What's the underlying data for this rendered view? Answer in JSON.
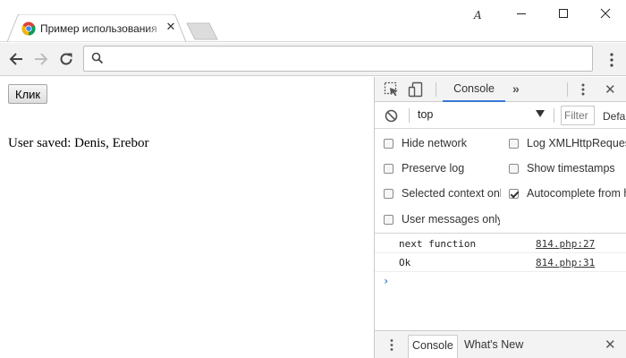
{
  "browser": {
    "tab": {
      "title": "Пример использования",
      "close_glyph": "✕",
      "active": true
    },
    "profile_label": "A",
    "omnibox": {
      "value": "",
      "placeholder": ""
    },
    "colors": {
      "accent": "#3879d9",
      "toolbar": "#f2f2f2"
    }
  },
  "page": {
    "button_label": "Клик",
    "output_text": "User saved: Denis, Erebor"
  },
  "devtools": {
    "tabs": [
      {
        "label": "Console",
        "active": true
      }
    ],
    "more_tabs_glyph": "»",
    "close_glyph": "✕",
    "context": "top",
    "filter_placeholder": "Filter",
    "levels_label": "Default levels",
    "settings": {
      "left": [
        {
          "label": "Hide network",
          "checked": false
        },
        {
          "label": "Preserve log",
          "checked": false
        },
        {
          "label": "Selected context only",
          "checked": false
        },
        {
          "label": "User messages only",
          "checked": false
        }
      ],
      "right": [
        {
          "label": "Log XMLHttpRequests",
          "checked": false
        },
        {
          "label": "Show timestamps",
          "checked": false
        },
        {
          "label": "Autocomplete from history",
          "checked": true
        }
      ]
    },
    "console_messages": [
      {
        "text": "next function",
        "source": "814.php:27"
      },
      {
        "text": "Ok",
        "source": "814.php:31"
      }
    ],
    "prompt_glyph": "›",
    "drawer": {
      "tabs": [
        {
          "label": "Console",
          "active": true
        },
        {
          "label": "What's New",
          "active": false
        }
      ],
      "close_glyph": "✕"
    }
  }
}
